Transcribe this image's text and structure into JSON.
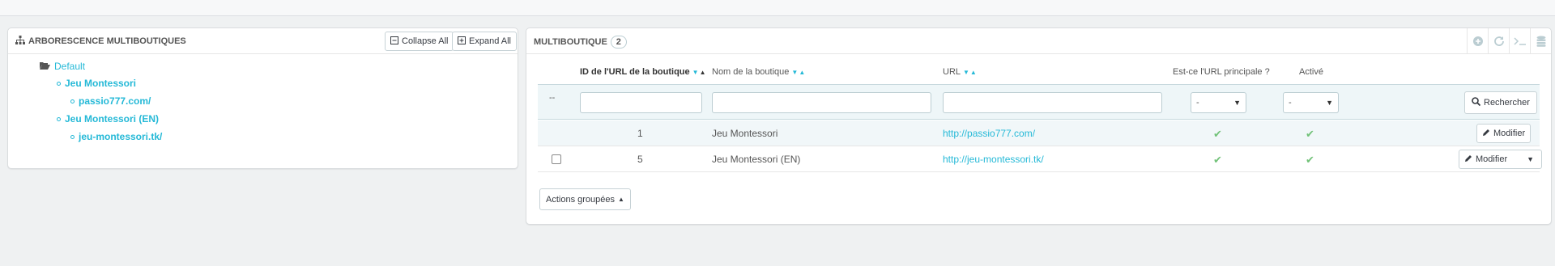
{
  "colors": {
    "accent": "#25b9d7",
    "success": "#72c279",
    "panel_bg": "#ffffff",
    "page_bg": "#eff1f2"
  },
  "tree_panel": {
    "title": "ARBORESCENCE MULTIBOUTIQUES",
    "title_icon": "sitemap-icon",
    "collapse_label": "Collapse All",
    "expand_label": "Expand All",
    "root_label": "Default",
    "shops": [
      {
        "name": "Jeu Montessori",
        "url": "passio777.com/"
      },
      {
        "name": "Jeu Montessori (EN)",
        "url": "jeu-montessori.tk/"
      }
    ]
  },
  "list_panel": {
    "title": "MULTIBOUTIQUE",
    "count": "2",
    "toolbar_icons": [
      "add-icon",
      "refresh-icon",
      "sql-icon",
      "database-icon"
    ],
    "columns": {
      "id": "ID de l'URL de la boutique",
      "shop_name": "Nom de la boutique",
      "url": "URL",
      "main_url": "Est-ce l'URL principale ?",
      "active": "Activé"
    },
    "filters": {
      "bulk_placeholder": "--",
      "main_select": "-",
      "active_select": "-",
      "search_label": "Rechercher"
    },
    "rows": [
      {
        "id": "1",
        "shop_name": "Jeu Montessori",
        "url": "http://passio777.com/",
        "main": "✔",
        "active": "✔",
        "action": "Modifier"
      },
      {
        "id": "5",
        "shop_name": "Jeu Montessori (EN)",
        "url": "http://jeu-montessori.tk/",
        "main": "✔",
        "active": "✔",
        "action": "Modifier"
      }
    ],
    "bulk_actions_label": "Actions groupées"
  }
}
